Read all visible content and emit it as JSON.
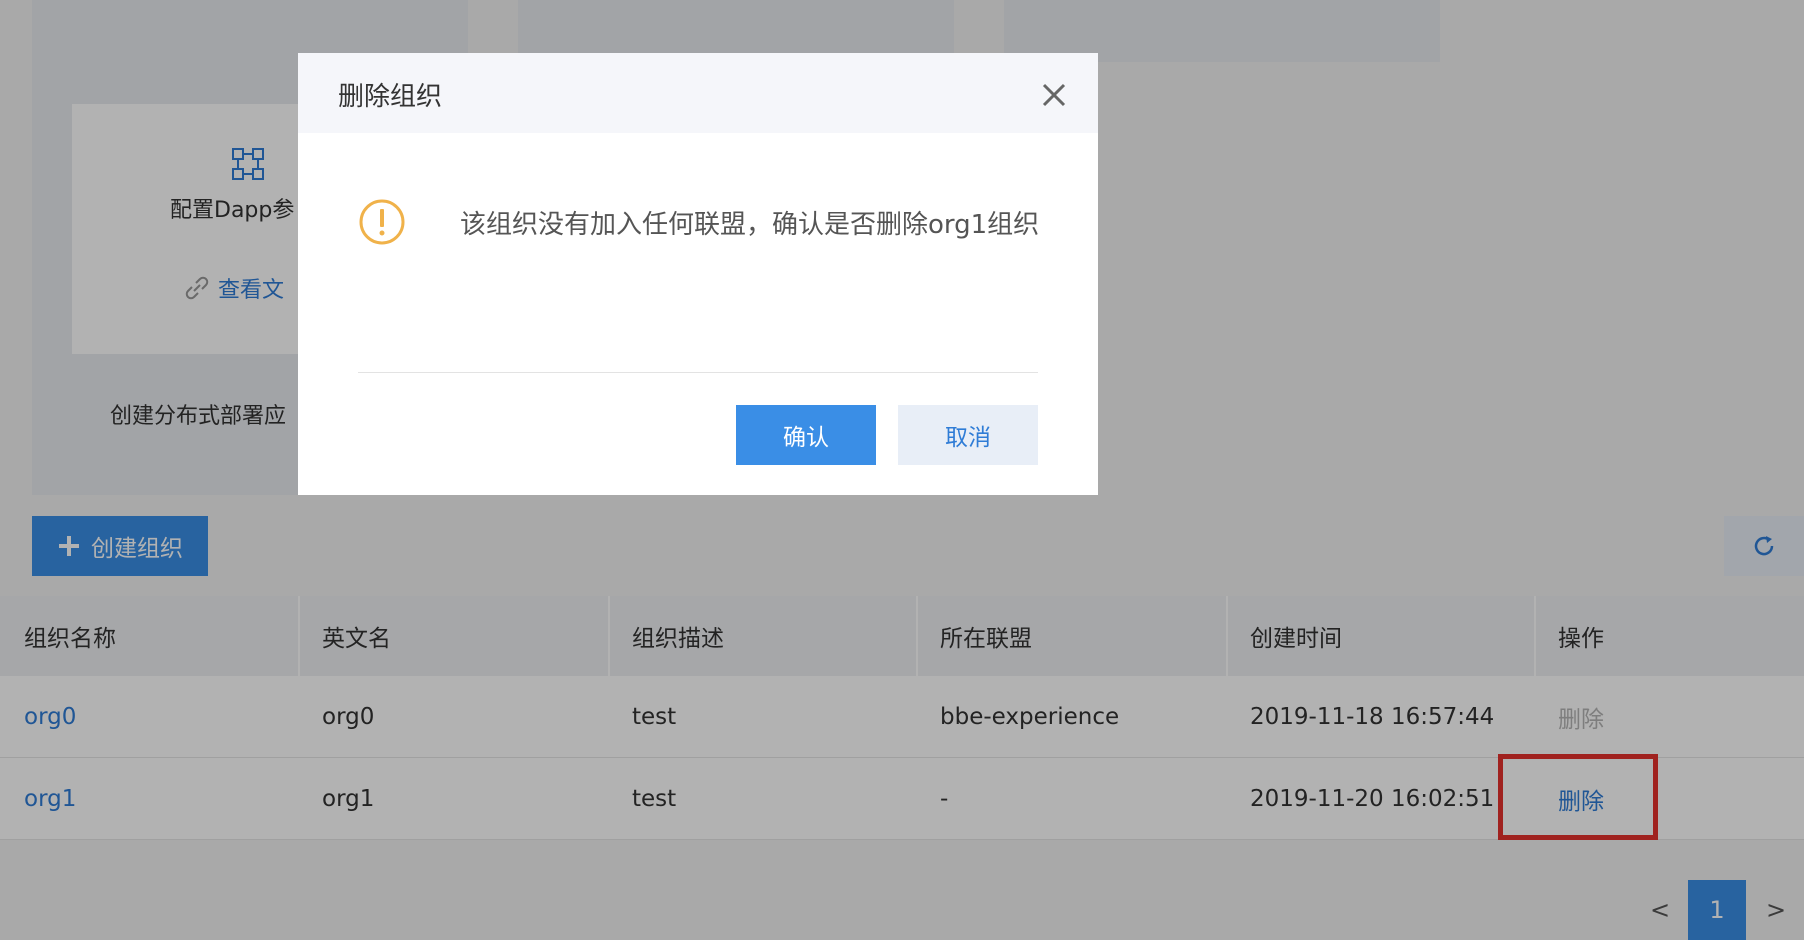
{
  "background": {
    "config_text": "配置Dapp参",
    "doc_link": "查看文",
    "create_app_text": "创建分布式部署应"
  },
  "toolbar": {
    "create_label": "创建组织",
    "refresh_icon": "refresh-icon"
  },
  "table": {
    "headers": [
      "组织名称",
      "英文名",
      "组织描述",
      "所在联盟",
      "创建时间",
      "操作"
    ],
    "rows": [
      {
        "name": "org0",
        "en_name": "org0",
        "desc": "test",
        "alliance": "bbe-experience",
        "created": "2019-11-18 16:57:44",
        "action": "删除",
        "action_enabled": false
      },
      {
        "name": "org1",
        "en_name": "org1",
        "desc": "test",
        "alliance": "-",
        "created": "2019-11-20 16:02:51",
        "action": "删除",
        "action_enabled": true
      }
    ]
  },
  "pagination": {
    "prev": "<",
    "current": "1",
    "next": ">"
  },
  "modal": {
    "title": "删除组织",
    "message": "该组织没有加入任何联盟，确认是否删除org1组织",
    "confirm": "确认",
    "cancel": "取消"
  },
  "colors": {
    "primary": "#3a8ee6",
    "link": "#2f7cd6",
    "warning": "#f0b24a",
    "highlight": "#e5322d"
  }
}
